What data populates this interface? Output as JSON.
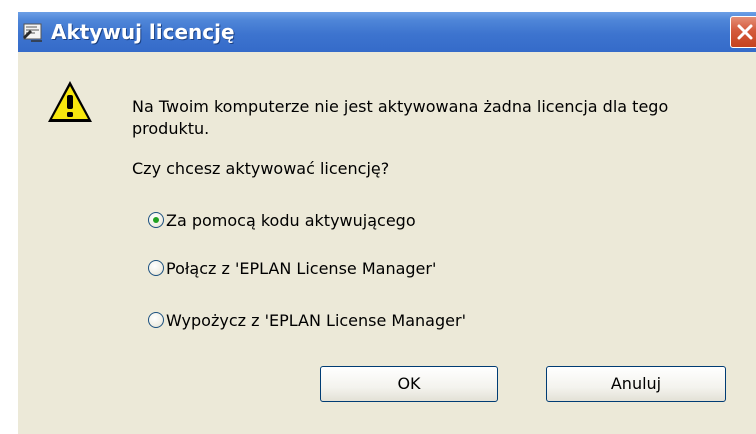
{
  "window": {
    "title": "Aktywuj licencję",
    "icon": "app-document-icon",
    "close_icon": "close-icon"
  },
  "dialog": {
    "icon": "warning-icon",
    "message_line1": "Na Twoim komputerze nie jest aktywowana żadna licencja dla tego",
    "message_line2": "produktu.",
    "question": "Czy chcesz aktywować licencję?"
  },
  "options": [
    {
      "label": "Za pomocą kodu aktywującego",
      "selected": true
    },
    {
      "label": "Połącz z 'EPLAN License Manager'",
      "selected": false
    },
    {
      "label": "Wypożycz z 'EPLAN License Manager'",
      "selected": false
    }
  ],
  "buttons": {
    "ok_label": "OK",
    "cancel_label": "Anuluj"
  },
  "colors": {
    "titlebar": "#3d74cf",
    "dialog_bg": "#ece9d8",
    "close_button": "#d45a3c",
    "radio_selected": "#21a121"
  }
}
